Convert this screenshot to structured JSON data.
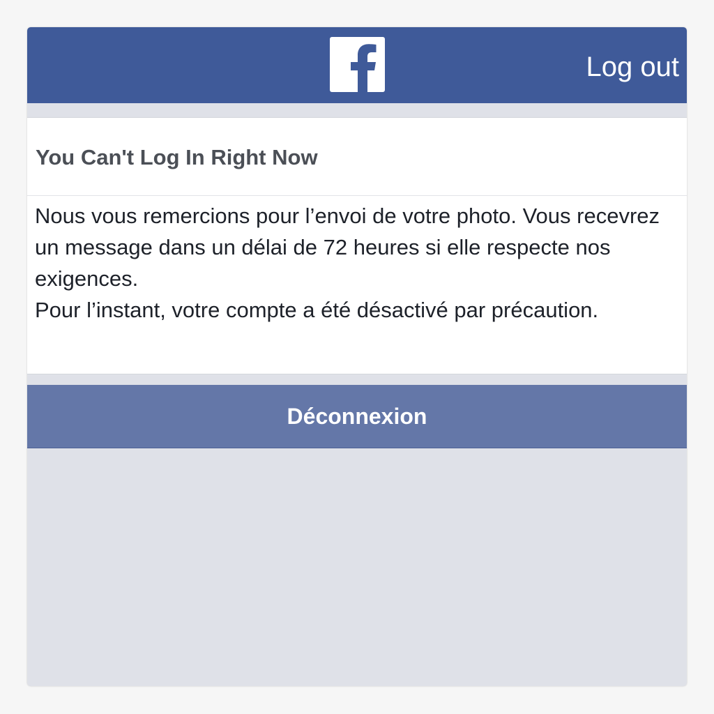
{
  "header": {
    "brand_icon": "facebook-f-icon",
    "logout_label": "Log out",
    "background_color": "#3f5a99"
  },
  "notice": {
    "title": "You Can't Log In Right Now",
    "paragraphs": [
      "Nous vous remercions pour l’envoi de votre photo. Vous recevrez un message dans un délai de 72 heures si elle respecte nos exigences.",
      "Pour l’instant, votre compte a été désactivé par précaution."
    ]
  },
  "actions": {
    "logout_button_label": "Déconnexion",
    "button_color": "#6477a8"
  }
}
